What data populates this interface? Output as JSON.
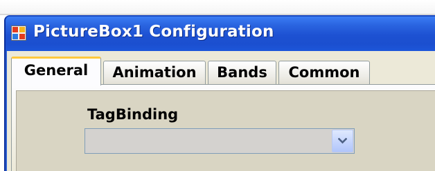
{
  "window": {
    "title": "PictureBox1 Configuration",
    "icon": "app-window-icon"
  },
  "tabs": [
    {
      "label": "General",
      "active": true
    },
    {
      "label": "Animation",
      "active": false
    },
    {
      "label": "Bands",
      "active": false
    },
    {
      "label": "Common",
      "active": false
    }
  ],
  "general": {
    "tag_binding_label": "TagBinding",
    "tag_binding_value": ""
  },
  "icons": {
    "dropdown": "chevron-down-icon"
  },
  "colors": {
    "titlebar": "#2458d8",
    "active_tab_highlight": "#ffc83c",
    "dialog_face": "#ece9d8"
  }
}
